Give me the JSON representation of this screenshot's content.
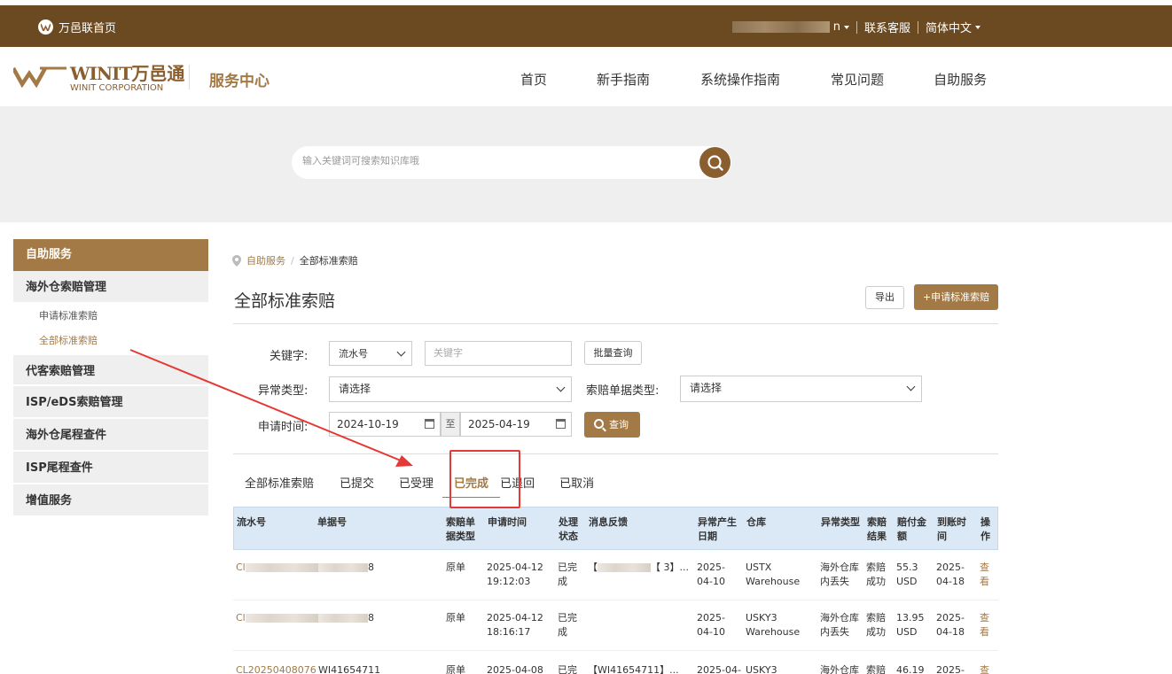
{
  "topbar": {
    "home_label": "万邑联首页",
    "user_suffix": "n",
    "support": "联系客服",
    "language": "简体中文"
  },
  "header": {
    "logo_mark": "WINIT",
    "logo_cn": "万邑通",
    "logo_en": "WINIT CORPORATION",
    "service_center": "服务中心",
    "nav": [
      "首页",
      "新手指南",
      "系统操作指南",
      "常见问题",
      "自助服务"
    ]
  },
  "search": {
    "placeholder": "输入关键词可搜索知识库哦"
  },
  "sidebar": {
    "title": "自助服务",
    "group1": "海外仓索赔管理",
    "sub1": "申请标准索赔",
    "sub2": "全部标准索赔",
    "group2": "代客索赔管理",
    "group3": "ISP/eDS索赔管理",
    "group4": "海外仓尾程查件",
    "group5": "ISP尾程查件",
    "group6": "增值服务"
  },
  "breadcrumb": {
    "parent": "自助服务",
    "sep": "/",
    "current": "全部标准索赔"
  },
  "page": {
    "title": "全部标准索赔",
    "export": "导出",
    "apply": "+申请标准索赔"
  },
  "filters": {
    "keyword_label": "关键字:",
    "keyword_type": "流水号",
    "keyword_placeholder": "关键字",
    "batch_query": "批量查询",
    "exception_label": "异常类型:",
    "exception_value": "请选择",
    "doc_type_label": "索赔单据类型:",
    "doc_type_value": "请选择",
    "date_label": "申请时间:",
    "date_from": "2024-10-19",
    "date_to_sep": "至",
    "date_to": "2025-04-19",
    "query": "查询"
  },
  "tabs": [
    "全部标准索赔",
    "已提交",
    "已受理",
    "已完成",
    "已退回",
    "已取消"
  ],
  "active_tab": "已完成",
  "table": {
    "headers": {
      "serial": "流水号",
      "doc_no": "单据号",
      "claim_doc_type": "索赔单据类型",
      "apply_time": "申请时间",
      "status": "处理状态",
      "feedback": "消息反馈",
      "exception_date": "异常产生日期",
      "warehouse": "仓库",
      "exception_type": "异常类型",
      "result": "索赔结果",
      "amount": "赔付金额",
      "arrival_time": "到账时间",
      "action": "操作"
    },
    "rows": [
      {
        "serial": "Cl",
        "doc_no_suffix": "8",
        "claim_doc_type": "原单",
        "apply_time": "2025-04-12 19:12:03",
        "status": "已完成",
        "feedback": "【 3】...",
        "exception_date": "2025-04-10",
        "warehouse": "USTX Warehouse",
        "exception_type": "海外仓库内丢失",
        "result": "索赔成功",
        "amount": "55.3 USD",
        "arrival_time": "2025-04-18",
        "action": "查看"
      },
      {
        "serial": "Cl",
        "doc_no_suffix": "8",
        "claim_doc_type": "原单",
        "apply_time": "2025-04-12 18:16:17",
        "status": "已完成",
        "feedback": "",
        "exception_date": "2025-04-10",
        "warehouse": "USKY3 Warehouse",
        "exception_type": "海外仓库内丢失",
        "result": "索赔成功",
        "amount": "13.95 USD",
        "arrival_time": "2025-04-18",
        "action": "查看"
      },
      {
        "serial": "CL20250408076",
        "doc_no": "WI41654711",
        "claim_doc_type": "原单",
        "apply_time": "2025-04-08",
        "status": "已完",
        "feedback": "【WI41654711】...",
        "exception_date": "2025-04-",
        "warehouse": "USKY3",
        "exception_type": "海外仓库",
        "result": "索赔",
        "amount": "46.19",
        "arrival_time": "2025-",
        "action": "查"
      }
    ]
  },
  "colors": {
    "brand_brown": "#6b4a22",
    "accent": "#a37a46",
    "annotation_red": "#e53935"
  }
}
